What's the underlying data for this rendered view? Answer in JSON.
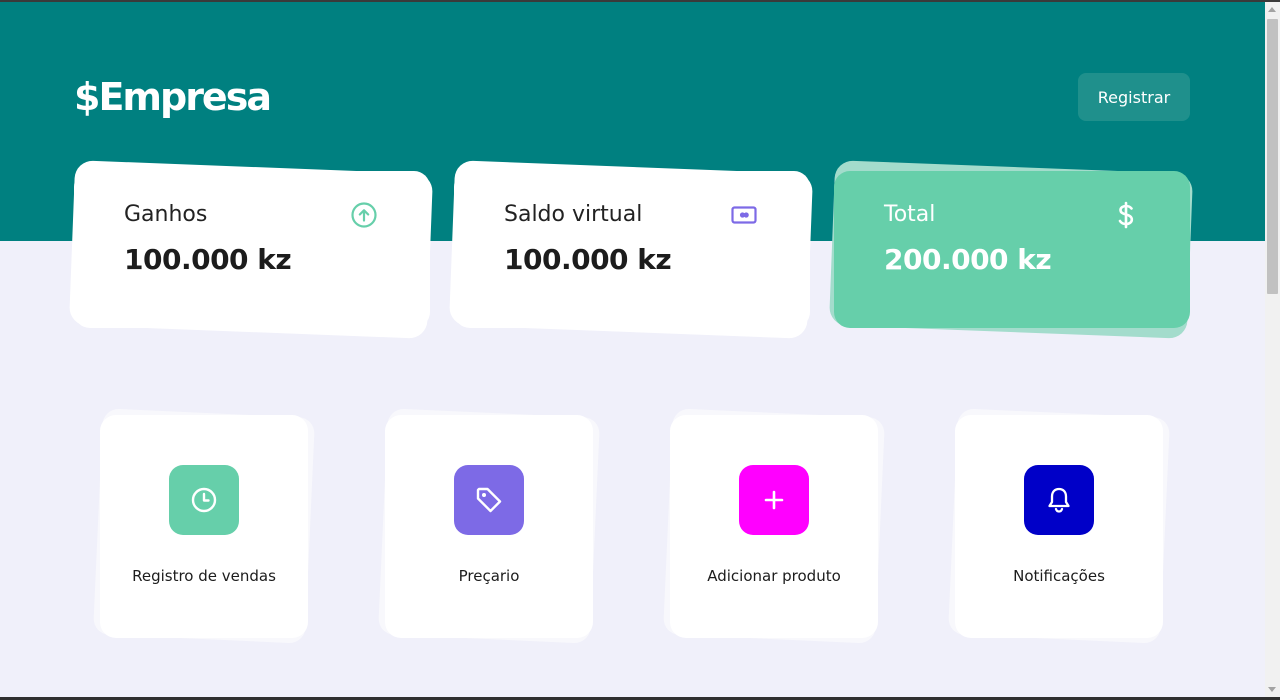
{
  "header": {
    "logo": "$Empresa",
    "register_label": "Registrar",
    "color": "#008080"
  },
  "summary_cards": [
    {
      "title": "Ganhos",
      "value": "100.000 kz",
      "icon": "arrow-up-circle-icon",
      "icon_color": "#66cfaa"
    },
    {
      "title": "Saldo virtual",
      "value": "100.000 kz",
      "icon": "money-card-icon",
      "icon_color": "#7d6ae6"
    },
    {
      "title": "Total",
      "value": "200.000 kz",
      "icon": "dollar-icon",
      "background": "#66cfaa"
    }
  ],
  "actions": [
    {
      "label": "Registro de vendas",
      "icon": "clock-icon",
      "color": "#66cfaa"
    },
    {
      "label": "Preçario",
      "icon": "tag-icon",
      "color": "#7d6ae6"
    },
    {
      "label": "Adicionar produto",
      "icon": "plus-icon",
      "color": "#ff00ff"
    },
    {
      "label": "Notificações",
      "icon": "bell-icon",
      "color": "#0000c8"
    }
  ],
  "colors": {
    "page_background": "#f0f0fa",
    "card_background": "#ffffff",
    "accent_green": "#66cfaa"
  }
}
